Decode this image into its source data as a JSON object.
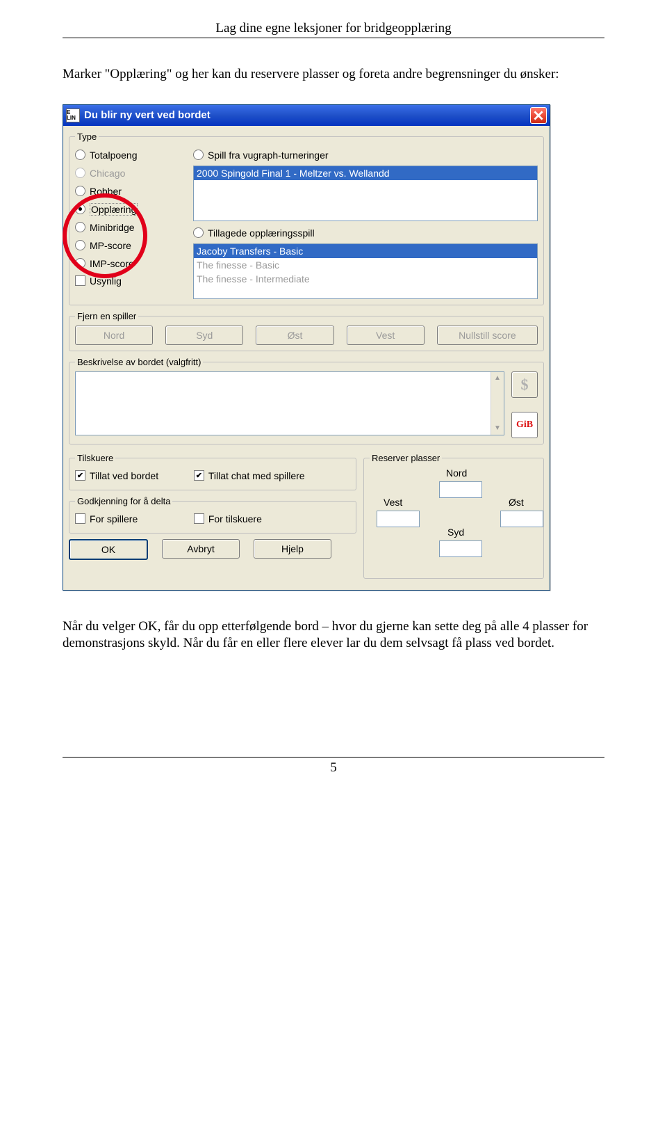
{
  "header": "Lag dine egne leksjoner for bridgeopplæring",
  "intro": "Marker \"Opplæring\" og her kan du  reservere plasser og foreta andre begrensninger du ønsker:",
  "dialog": {
    "title": "Du blir ny vert ved bordet",
    "icon_text": "E LIN",
    "type": {
      "legend": "Type",
      "left": [
        {
          "label": "Totalpoeng",
          "selected": false,
          "disabled": false
        },
        {
          "label": "Chicago",
          "selected": false,
          "disabled": true
        },
        {
          "label": "Robber",
          "selected": false,
          "disabled": false
        },
        {
          "label": "Opplæring",
          "selected": true,
          "disabled": false
        },
        {
          "label": "Minibridge",
          "selected": false,
          "disabled": false
        },
        {
          "label": "MP-score",
          "selected": false,
          "disabled": false
        },
        {
          "label": "IMP-score",
          "selected": false,
          "disabled": false
        }
      ],
      "usynlig": "Usynlig",
      "right_radio1": "Spill fra vugraph-turneringer",
      "list1": [
        {
          "text": "2000 Spingold Final 1 - Meltzer vs. Wellandd",
          "sel": true
        }
      ],
      "right_radio2": "Tillagede opplæringsspill",
      "list2": [
        {
          "text": "Jacoby Transfers - Basic",
          "sel": true
        },
        {
          "text": "The finesse - Basic",
          "sel": false,
          "dim": true
        },
        {
          "text": "The finesse - Intermediate",
          "sel": false,
          "dim": true
        }
      ]
    },
    "fjern": {
      "legend": "Fjern en spiller",
      "buttons": [
        "Nord",
        "Syd",
        "Øst",
        "Vest",
        "Nullstill score"
      ]
    },
    "desc": {
      "legend": "Beskrivelse av bordet (valgfritt)",
      "gib": "GiB"
    },
    "tilskuere": {
      "legend": "Tilskuere",
      "opt1": "Tillat ved bordet",
      "opt2": "Tillat chat med spillere"
    },
    "godkjenning": {
      "legend": "Godkjenning for å delta",
      "opt1": "For spillere",
      "opt2": "For tilskuere"
    },
    "reserver": {
      "legend": "Reserver plasser",
      "nord": "Nord",
      "vest": "Vest",
      "ost": "Øst",
      "syd": "Syd"
    },
    "buttons": {
      "ok": "OK",
      "cancel": "Avbryt",
      "help": "Hjelp"
    }
  },
  "outro": "Når du velger OK, får du opp etterfølgende bord – hvor du gjerne kan sette deg på alle 4 plasser for demonstrasjons skyld. Når du får en eller flere elever lar du dem selvsagt få plass ved bordet.",
  "page_number": "5"
}
